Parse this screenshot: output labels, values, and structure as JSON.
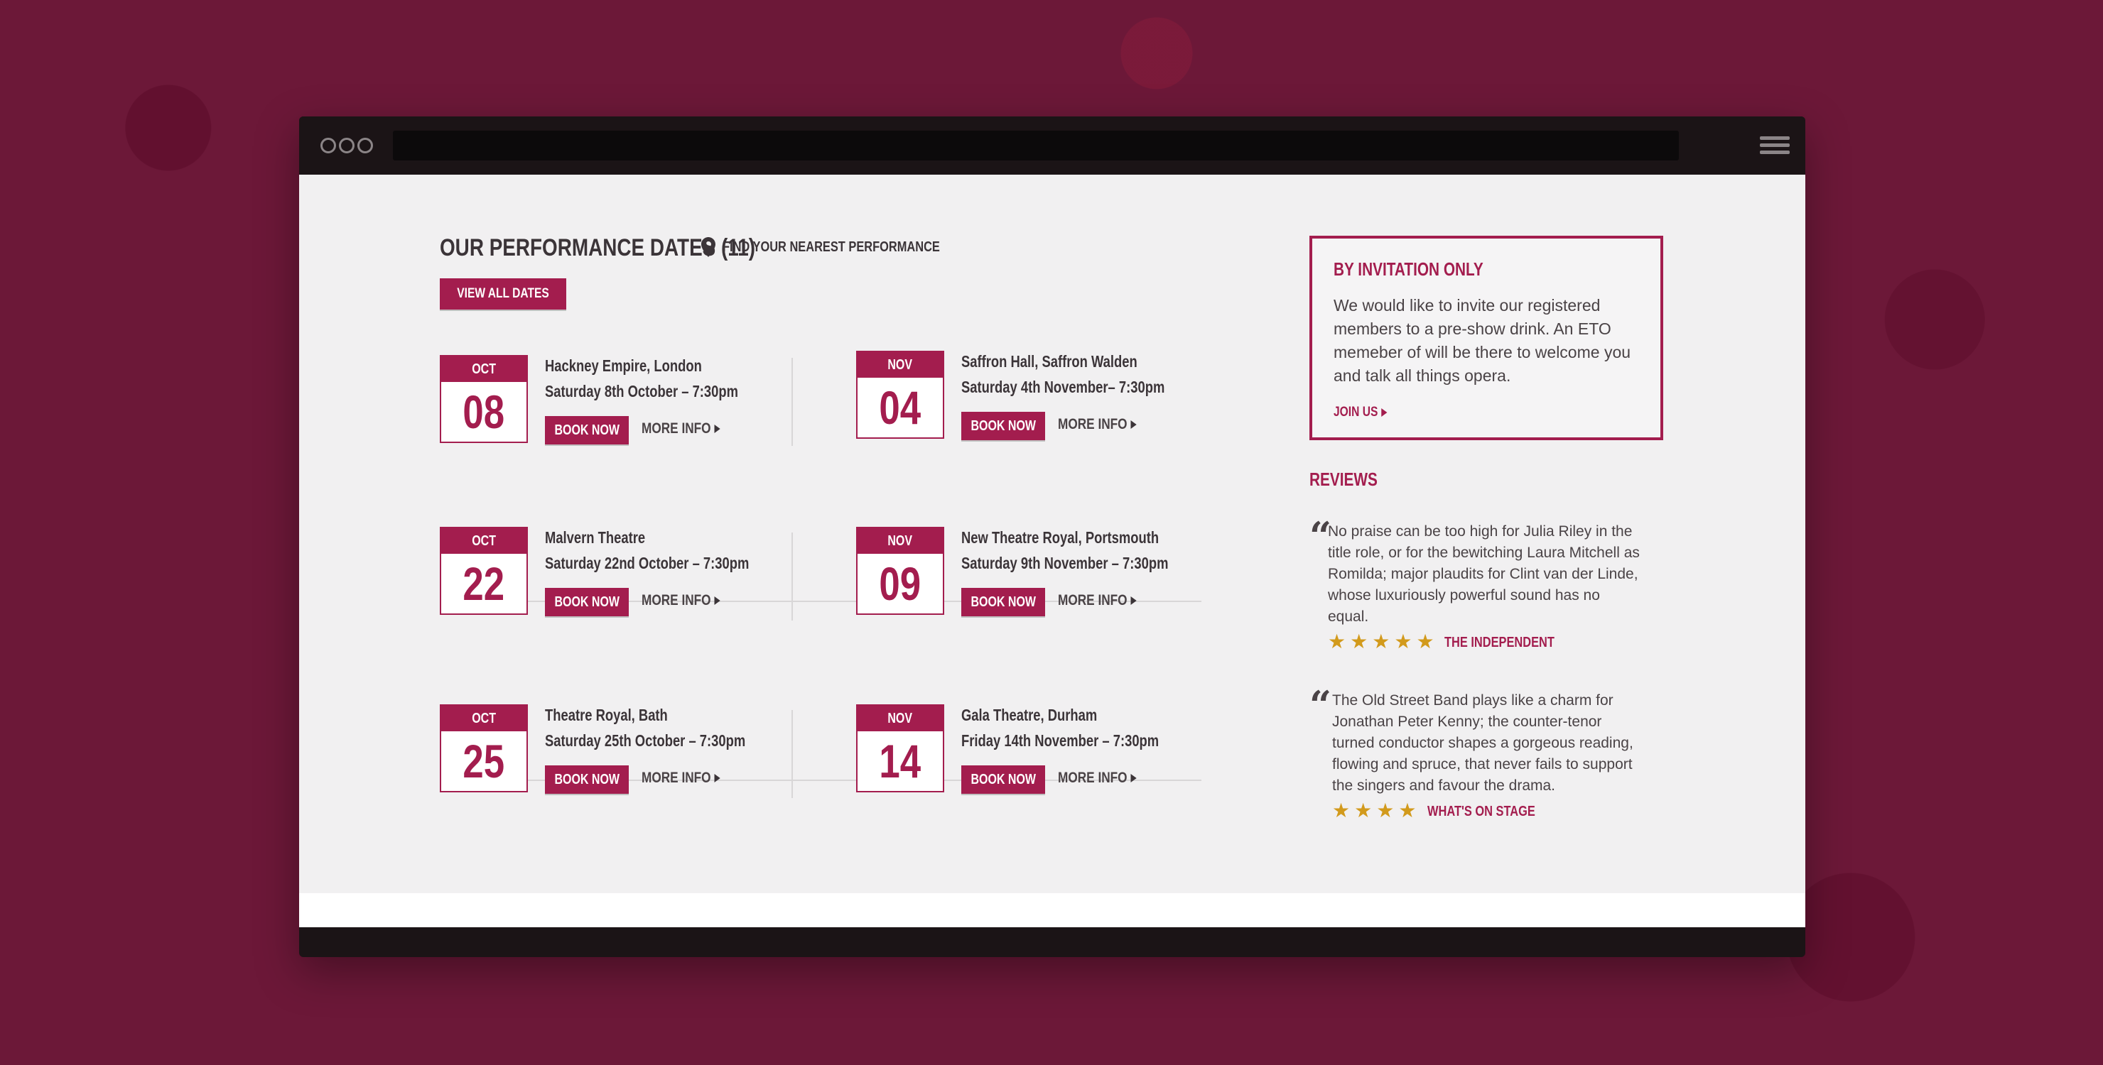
{
  "browser": {
    "menu_icon": "hamburger-menu-icon"
  },
  "performances": {
    "title": "OUR PERFORMANCE DATES (11)",
    "find_label": "FIND YOUR NEAREST PERFORMANCE",
    "view_all_label": "VIEW ALL DATES",
    "book_label": "BOOK NOW",
    "more_label": "MORE INFO",
    "events": [
      {
        "month": "OCT",
        "day": "08",
        "venue": "Hackney Empire, London",
        "when": "Saturday 8th October – 7:30pm"
      },
      {
        "month": "NOV",
        "day": "04",
        "venue": "Saffron Hall, Saffron Walden",
        "when": "Saturday 4th November– 7:30pm"
      },
      {
        "month": "OCT",
        "day": "22",
        "venue": "Malvern Theatre",
        "when": "Saturday 22nd October – 7:30pm"
      },
      {
        "month": "NOV",
        "day": "09",
        "venue": "New Theatre Royal, Portsmouth",
        "when": "Saturday 9th November – 7:30pm"
      },
      {
        "month": "OCT",
        "day": "25",
        "venue": "Theatre Royal, Bath",
        "when": "Saturday 25th October – 7:30pm"
      },
      {
        "month": "NOV",
        "day": "14",
        "venue": "Gala Theatre, Durham",
        "when": "Friday 14th November – 7:30pm"
      }
    ]
  },
  "invitation": {
    "title": "BY INVITATION ONLY",
    "text": "We would like to invite our registered members to a pre-show drink. An ETO memeber of will be there to welcome you and talk all things opera.",
    "link": "JOIN US"
  },
  "reviews": {
    "title": "REVIEWS",
    "items": [
      {
        "text": "No praise can be too high for Julia Riley in the title role, or for the bewitching Laura Mitchell as Romilda; major plaudits for Clint van der Linde, whose luxuriously powerful sound has no equal.",
        "stars": 5,
        "source": "THE INDEPENDENT"
      },
      {
        "text": "The Old Street Band plays like a charm for Jonathan Peter Kenny; the counter-tenor turned conductor shapes a gorgeous reading, flowing and spruce, that never fails to support the singers and favour the drama.",
        "stars": 4,
        "source": "WHAT'S ON STAGE"
      }
    ]
  },
  "colors": {
    "brand": "#a31d4e",
    "background": "#6c1838",
    "star": "#d29a1c"
  }
}
